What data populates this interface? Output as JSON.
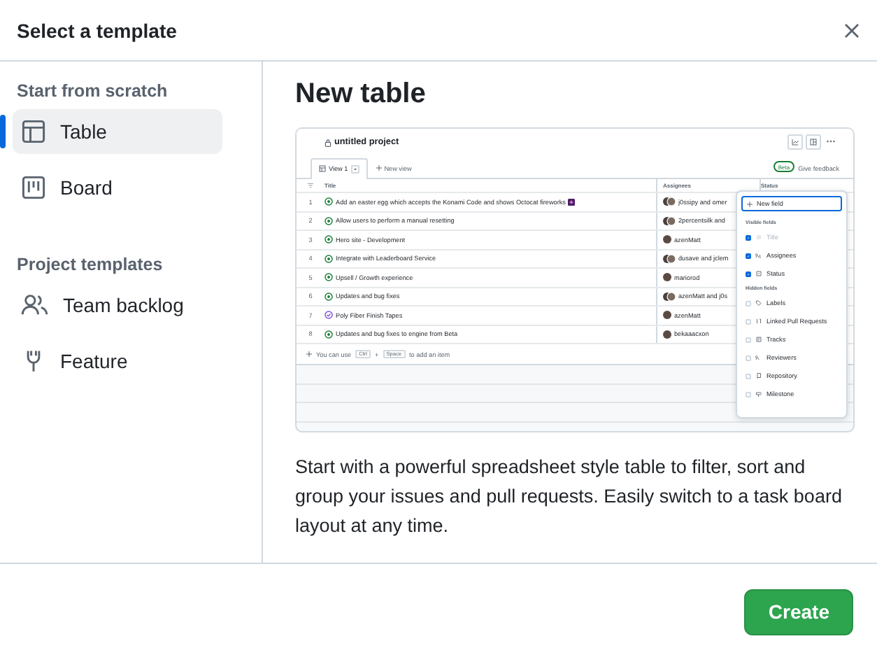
{
  "dialog": {
    "title": "Select a template"
  },
  "sidebar": {
    "sections": [
      {
        "heading": "Start from scratch",
        "items": [
          {
            "label": "Table",
            "selected": true
          },
          {
            "label": "Board",
            "selected": false
          }
        ]
      },
      {
        "heading": "Project templates",
        "items": [
          {
            "label": "Team backlog",
            "selected": false
          },
          {
            "label": "Feature",
            "selected": false
          }
        ]
      }
    ]
  },
  "main": {
    "heading": "New table",
    "preview": {
      "title": "untitled project",
      "views": [
        {
          "label": "View 1",
          "selected": true
        }
      ],
      "new_view": "New view",
      "beta": "Beta",
      "feedback": "Give feedback",
      "columns": [
        "Title",
        "Assignees",
        "Status"
      ],
      "rows": [
        {
          "number": "1",
          "title": "Add an easter egg which accepts the Konami Code and shows Octocat fireworks",
          "kind": "open",
          "emoji": true,
          "assignees": "j0ssipy and omer",
          "avatar_pair": true
        },
        {
          "number": "2",
          "title": "Allow users to perform a manual resetting",
          "kind": "open",
          "emoji": false,
          "assignees": "2percentsilk and",
          "avatar_pair": true
        },
        {
          "number": "3",
          "title": "Hero site - Development",
          "kind": "open",
          "emoji": false,
          "assignees": "azenMatt",
          "avatar_pair": false
        },
        {
          "number": "4",
          "title": "Integrate with Leaderboard Service",
          "kind": "open",
          "emoji": false,
          "assignees": "dusave and jclem",
          "avatar_pair": true
        },
        {
          "number": "5",
          "title": "Upsell / Growth experience",
          "kind": "open",
          "emoji": false,
          "assignees": "mariorod",
          "avatar_pair": false
        },
        {
          "number": "6",
          "title": "Updates and bug fixes",
          "kind": "open",
          "emoji": false,
          "assignees": "azenMatt and j0s",
          "avatar_pair": true
        },
        {
          "number": "7",
          "title": "Poly Fiber Finish Tapes",
          "kind": "closed",
          "emoji": false,
          "assignees": "azenMatt",
          "avatar_pair": false
        },
        {
          "number": "8",
          "title": "Updates and bug fixes to engine from Beta",
          "kind": "open",
          "emoji": false,
          "assignees": "bekaaacxon",
          "avatar_pair": false
        }
      ],
      "add_hint": {
        "before": "You can use",
        "keys": [
          "Ctrl",
          "Space"
        ],
        "joiner": "+",
        "after": "to add an item"
      },
      "fields_menu": {
        "new_field": "New field",
        "visible_heading": "Visible fields",
        "visible": [
          {
            "label": "Title",
            "checked": true,
            "disabled": true
          },
          {
            "label": "Assignees",
            "checked": true,
            "disabled": false
          },
          {
            "label": "Status",
            "checked": true,
            "disabled": false
          }
        ],
        "hidden_heading": "Hidden fields",
        "hidden": [
          {
            "label": "Labels",
            "checked": false,
            "disabled": false
          },
          {
            "label": "Linked Pull Requests",
            "checked": false,
            "disabled": false
          },
          {
            "label": "Tracks",
            "checked": false,
            "disabled": false
          },
          {
            "label": "Reviewers",
            "checked": false,
            "disabled": false
          },
          {
            "label": "Repository",
            "checked": false,
            "disabled": false
          },
          {
            "label": "Milestone",
            "checked": false,
            "disabled": false
          }
        ]
      }
    },
    "description": "Start with a powerful spreadsheet style table to filter, sort and group your issues and pull requests. Easily switch to a task board layout at any time."
  },
  "footer": {
    "create_button": "Create"
  }
}
